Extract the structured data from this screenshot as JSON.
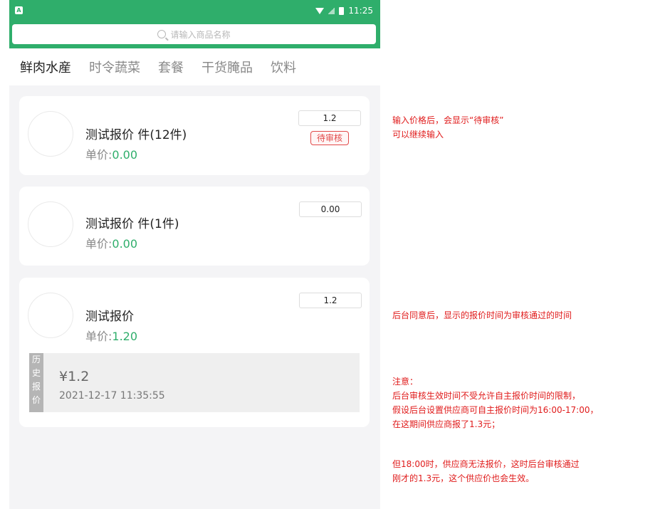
{
  "statusbar": {
    "app_icon": "A",
    "time": "11:25",
    "icons": [
      "wifi-icon",
      "signal-icon",
      "battery-icon"
    ]
  },
  "search": {
    "placeholder": "请输入商品名称"
  },
  "tabs": [
    {
      "label": "鲜肉水産",
      "active": true
    },
    {
      "label": "时令蔬菜",
      "active": false
    },
    {
      "label": "套餐",
      "active": false
    },
    {
      "label": "干货腌品",
      "active": false
    },
    {
      "label": "饮料",
      "active": false
    }
  ],
  "products": [
    {
      "name": "测试报价 件(12件)",
      "price_label": "单价:",
      "price_value": "0.00",
      "input_value": "1.2",
      "badge": "待审核"
    },
    {
      "name": "测试报价 件(1件)",
      "price_label": "单价:",
      "price_value": "0.00",
      "input_value": "0.00"
    },
    {
      "name": "测试报价",
      "price_label": "单价:",
      "price_value": "1.20",
      "input_value": "1.2",
      "history": {
        "label_chars": [
          "历",
          "史",
          "报",
          "价"
        ],
        "price": "¥1.2",
        "time": "2021-12-17 11:35:55"
      }
    }
  ],
  "notes": {
    "note1": [
      "输入价格后，会显示“待审核”",
      "可以继续输入"
    ],
    "note2": [
      "后台同意后，显示的报价时间为审核通过的时间"
    ],
    "note3": [
      "注意：",
      "后台审核生效时间不受允许自主报价时间的限制，",
      "假设后台设置供应商可自主报价时间为16:00-17:00，",
      "在这期间供应商报了1.3元；"
    ],
    "note4": [
      "但18:00时，供应商无法报价，这时后台审核通过",
      "刚才的1.3元，这个供应价也会生效。"
    ]
  },
  "colors": {
    "brand_green": "#2fae6b",
    "annotation_red": "#e01b1b",
    "badge_red": "#e24a4a"
  }
}
